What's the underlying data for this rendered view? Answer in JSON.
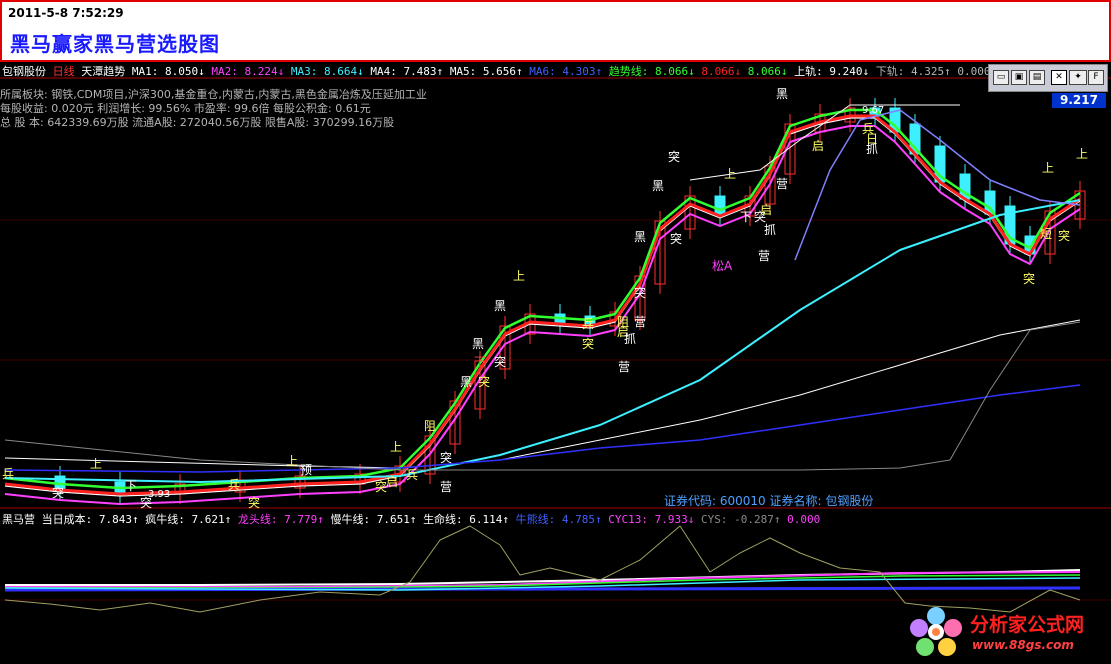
{
  "banner": {
    "datetime": "2011-5-8 7:52:29",
    "title": "黑马赢家黑马营选股图"
  },
  "main_indicator_row": [
    {
      "text": "包钢股份",
      "color": "#ffffff"
    },
    {
      "text": " 日线",
      "color": "#ff3030"
    },
    {
      "text": "  天潭趋势  ",
      "color": "#ffffff"
    },
    {
      "text": "MA1: 8.050↓ ",
      "color": "#ffffff"
    },
    {
      "text": "MA2: 8.224↓ ",
      "color": "#ff40ff"
    },
    {
      "text": "MA3: 8.664↓ ",
      "color": "#3cf0ff"
    },
    {
      "text": "MA4: 7.483↑ ",
      "color": "#ffffff"
    },
    {
      "text": "MA5: 5.656↑ ",
      "color": "#ffffff"
    },
    {
      "text": "MA6: 4.303↑ ",
      "color": "#4060ff"
    },
    {
      "text": "趋势线: 8.066↓ ",
      "color": "#30ff30"
    },
    {
      "text": "8.066↓ ",
      "color": "#ff2020"
    },
    {
      "text": "8.066↓ ",
      "color": "#30ff30"
    },
    {
      "text": "上轨: 9.240↓ ",
      "color": "#ffffff"
    },
    {
      "text": "下轨: 4.325↑ ",
      "color": "#b4b4b4"
    },
    {
      "text": "0.000",
      "color": "#b4b4b4"
    }
  ],
  "stock_info": [
    "所属板块: 钢铁,CDM项目,沪深300,基金重仓,内蒙古,内蒙古,黑色金属冶炼及压延加工业",
    "每股收益: 0.020元    利润增长: 99.56%    市盈率: 99.6倍   每股公积金: 0.61元",
    "总 股 本: 642339.69万股  流通A股: 272040.56万股   限售A股: 370299.16万股"
  ],
  "price_label": "9.217",
  "high_label": "9.67",
  "low_label": "3.93",
  "stock_code_text": "证券代码: 600010  证券名称: 包钢股份",
  "sub_indicator_row": [
    {
      "text": "黑马营 当日成本: 7.843↑ ",
      "color": "#ffffff"
    },
    {
      "text": "疯牛线: 7.621↑ ",
      "color": "#ffffff"
    },
    {
      "text": "龙头线: 7.779↑ ",
      "color": "#ff40ff"
    },
    {
      "text": "慢牛线: 7.651↑ ",
      "color": "#ffffff"
    },
    {
      "text": "生命线: 6.114↑ ",
      "color": "#ffffff"
    },
    {
      "text": "牛熊线: 4.785↑ ",
      "color": "#4060ff"
    },
    {
      "text": "CYC13: 7.933↓ ",
      "color": "#ff40ff"
    },
    {
      "text": "CYS: -0.287↑ ",
      "color": "#888888"
    },
    {
      "text": "0.000",
      "color": "#ff40ff"
    }
  ],
  "toolbar": {
    "btn_f": "F",
    "btn_star": "✦"
  },
  "signal_labels": [
    {
      "text": "兵",
      "color": "#ffff66"
    },
    {
      "text": "突",
      "color": "#ffffff"
    },
    {
      "text": "上",
      "color": "#ffff66"
    },
    {
      "text": "下",
      "color": "#ffffff"
    },
    {
      "text": "突",
      "color": "#ffffff"
    },
    {
      "text": "兵",
      "color": "#ffff66"
    },
    {
      "text": "突",
      "color": "#ffff66"
    },
    {
      "text": "上",
      "color": "#ffff66"
    },
    {
      "text": "预",
      "color": "#ffffff"
    },
    {
      "text": "上",
      "color": "#ffff66"
    },
    {
      "text": "突",
      "color": "#ffff66"
    },
    {
      "text": "启",
      "color": "#ffff66"
    },
    {
      "text": "突",
      "color": "#ffffff"
    },
    {
      "text": "兵",
      "color": "#ffff66"
    },
    {
      "text": "营",
      "color": "#ffffff"
    },
    {
      "text": "阻",
      "color": "#ffff66"
    },
    {
      "text": "黑",
      "color": "#ffffff"
    },
    {
      "text": "突",
      "color": "#ffff66"
    },
    {
      "text": "黑",
      "color": "#ffffff"
    },
    {
      "text": "下",
      "color": "#ff4040"
    },
    {
      "text": "突",
      "color": "#ffffff"
    },
    {
      "text": "黑",
      "color": "#ffffff"
    },
    {
      "text": "上",
      "color": "#ffff66"
    },
    {
      "text": "兵",
      "color": "#ffff66"
    },
    {
      "text": "突",
      "color": "#ffff66"
    },
    {
      "text": "阻",
      "color": "#ffff66"
    },
    {
      "text": "启",
      "color": "#ffff66"
    },
    {
      "text": "突",
      "color": "#ffffff"
    },
    {
      "text": "抓",
      "color": "#ffffff"
    },
    {
      "text": "营",
      "color": "#ffffff"
    },
    {
      "text": "营",
      "color": "#ffffff"
    },
    {
      "text": "黑",
      "color": "#ffffff"
    },
    {
      "text": "突",
      "color": "#ffffff"
    },
    {
      "text": "黑",
      "color": "#ffffff"
    },
    {
      "text": "突",
      "color": "#ffffff"
    },
    {
      "text": "松A",
      "color": "#ff40ff"
    },
    {
      "text": "上",
      "color": "#ffff66"
    },
    {
      "text": "下",
      "color": "#ffffff"
    },
    {
      "text": "突",
      "color": "#ffffff"
    },
    {
      "text": "启",
      "color": "#ffff66"
    },
    {
      "text": "抓",
      "color": "#ffffff"
    },
    {
      "text": "营",
      "color": "#ffffff"
    },
    {
      "text": "营",
      "color": "#ffffff"
    },
    {
      "text": "黑",
      "color": "#ffffff"
    },
    {
      "text": "启",
      "color": "#ffff66"
    },
    {
      "text": "兵",
      "color": "#ffff66"
    },
    {
      "text": "日",
      "color": "#ffff66"
    },
    {
      "text": "抓",
      "color": "#ffffff"
    },
    {
      "text": "上",
      "color": "#ffff66"
    },
    {
      "text": "突",
      "color": "#ffff66"
    },
    {
      "text": "短",
      "color": "#ffff66"
    },
    {
      "text": "突",
      "color": "#ffff66"
    },
    {
      "text": "上",
      "color": "#ffff66"
    }
  ],
  "watermark": {
    "text": "分析家公式网",
    "url": "www.88gs.com"
  }
}
